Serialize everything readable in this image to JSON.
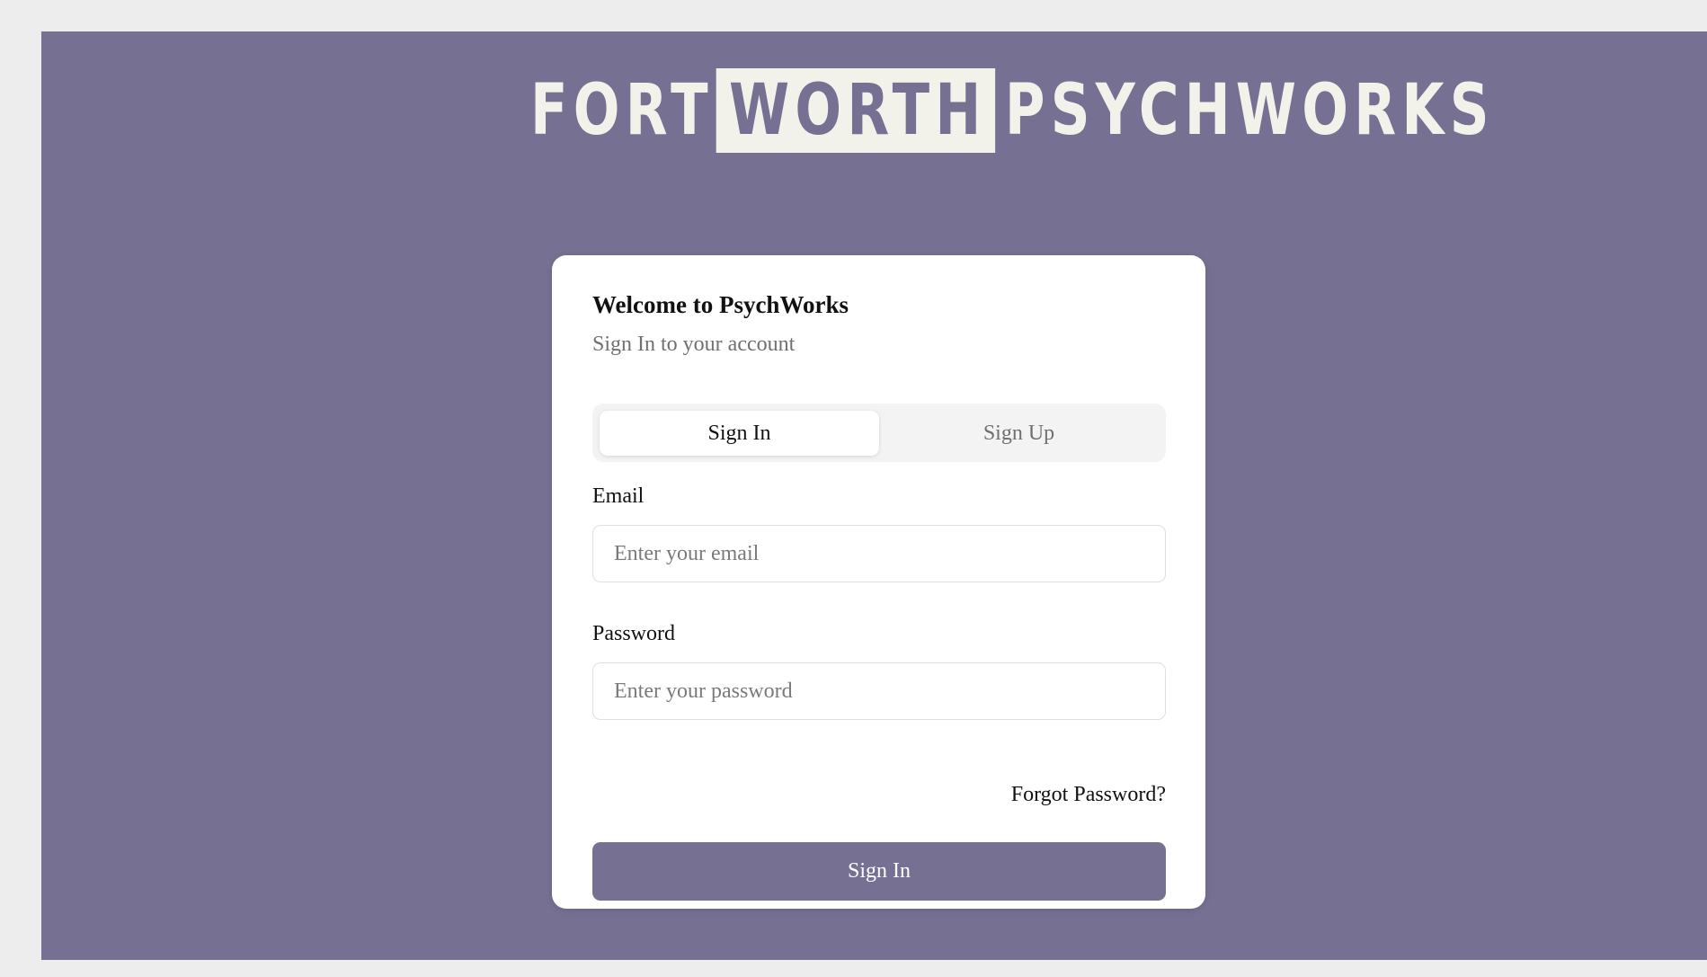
{
  "branding": {
    "logo_word_1": "FORT",
    "logo_word_2": "WORTH",
    "logo_word_3": "PSYCHWORKS",
    "accent_color": "#767092"
  },
  "card": {
    "title": "Welcome to PsychWorks",
    "subtitle": "Sign In to your account"
  },
  "tabs": [
    {
      "label": "Sign In",
      "active": true
    },
    {
      "label": "Sign Up",
      "active": false
    }
  ],
  "form": {
    "email": {
      "label": "Email",
      "placeholder": "Enter your email",
      "value": ""
    },
    "password": {
      "label": "Password",
      "placeholder": "Enter your password",
      "value": ""
    },
    "forgot_label": "Forgot Password?",
    "submit_label": "Sign In"
  }
}
